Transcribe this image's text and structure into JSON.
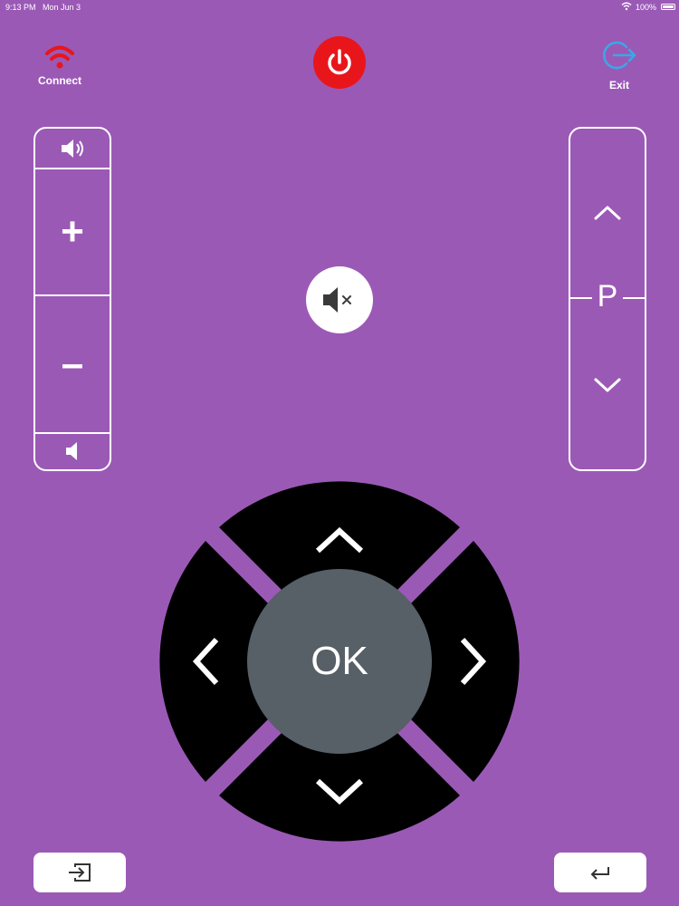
{
  "status_bar": {
    "time": "9:13 PM",
    "date": "Mon Jun 3",
    "battery": "100%"
  },
  "top_bar": {
    "connect_label": "Connect",
    "exit_label": "Exit"
  },
  "channel": {
    "label": "P"
  },
  "volume": {
    "plus": "+",
    "minus": "–"
  },
  "dpad": {
    "ok_label": "OK"
  },
  "colors": {
    "background": "#9b59b6",
    "power": "#e8161b",
    "connect_icon": "#e8161b",
    "exit_icon": "#3aa8e8",
    "dpad": "#000000",
    "ok": "#575f67"
  }
}
